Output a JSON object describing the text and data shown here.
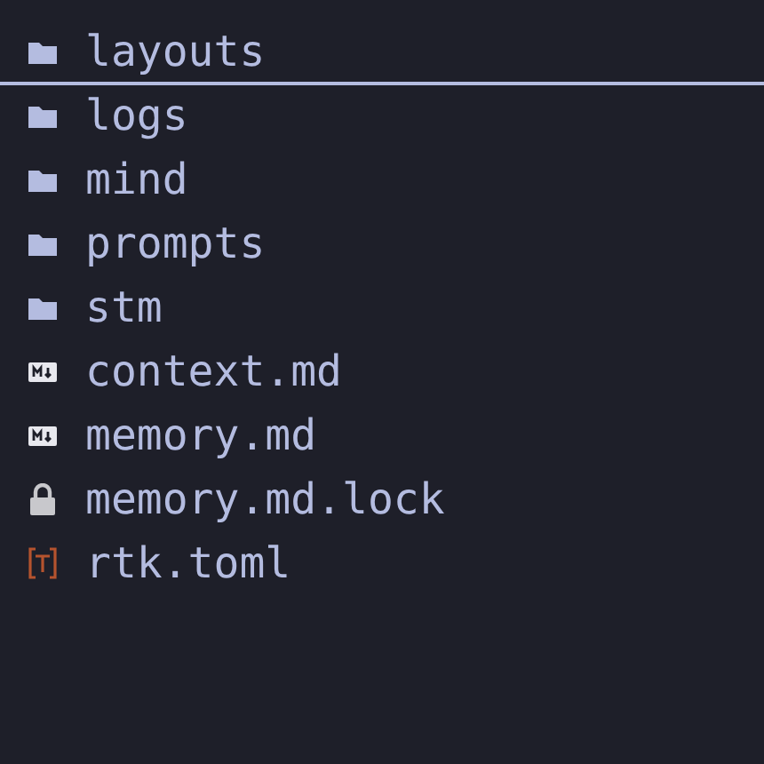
{
  "entries": [
    {
      "name": "layouts",
      "kind": "folder",
      "selected": true
    },
    {
      "name": "logs",
      "kind": "folder",
      "selected": false
    },
    {
      "name": "mind",
      "kind": "folder",
      "selected": false
    },
    {
      "name": "prompts",
      "kind": "folder",
      "selected": false
    },
    {
      "name": "stm",
      "kind": "folder",
      "selected": false
    },
    {
      "name": "context.md",
      "kind": "markdown",
      "selected": false
    },
    {
      "name": "memory.md",
      "kind": "markdown",
      "selected": false
    },
    {
      "name": "memory.md.lock",
      "kind": "lock",
      "selected": false
    },
    {
      "name": "rtk.toml",
      "kind": "toml",
      "selected": false
    }
  ]
}
